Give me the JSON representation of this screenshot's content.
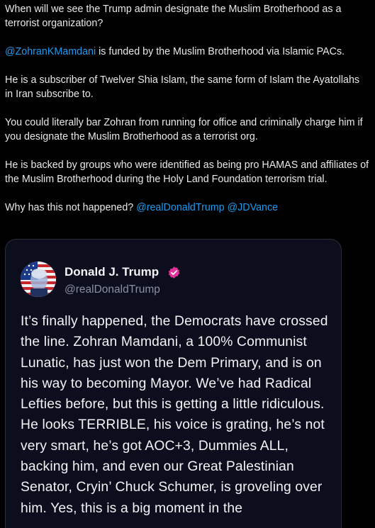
{
  "tweet": {
    "paragraphs": {
      "p1": "When will we see the Trump admin designate the Muslim Brotherhood as a terrorist organization?",
      "p2_mention": "@ZohranKMamdani",
      "p2_text": " is funded by the Muslim Brotherhood via Islamic PACs.",
      "p3": "He is a subscriber of Twelver Shia Islam, the same form of Islam the Ayatollahs in Iran subscribe to.",
      "p4": "You could literally bar Zohran from running for office and criminally charge him if you designate the Muslim Brotherhood as a terrorist org.",
      "p5": "He is backed by groups who were identified as being pro HAMAS and affiliates of the Muslim Brotherhood during the Holy Land Foundation terrorism trial.",
      "p6_text": "Why has this not happened? ",
      "p6_mention1": "@realDonaldTrump",
      "p6_mention2": "@JDVance"
    }
  },
  "quoted_post": {
    "author_name": "Donald J. Trump",
    "author_handle": "@realDonaldTrump",
    "verified_icon": "verified-badge-icon",
    "avatar": "profile-avatar",
    "body": "It’s finally happened, the Democrats have crossed the line. Zohran Mamdani, a 100% Communist Lunatic, has just won the Dem Primary, and is on his way to becoming Mayor. We’ve had Radical Lefties before, but this is getting a little ridiculous. He looks TERRIBLE, his voice is grating, he’s not very smart, he’s got AOC+3, Dummies ALL, backing him, and even our Great Palestinian Senator, Cryin’ Chuck Schumer, is groveling over him. Yes, this is a big moment in the"
  },
  "colors": {
    "background": "#000000",
    "text": "#e7e9ea",
    "link": "#1d9bf0",
    "card_background": "#0c0e1d",
    "verified": "#e0339a"
  }
}
